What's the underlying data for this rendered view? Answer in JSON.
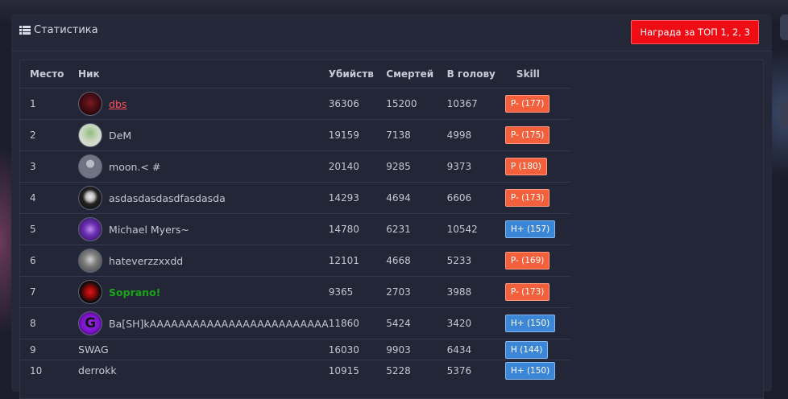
{
  "header": {
    "title": "Статистика",
    "title_icon": "list-icon",
    "reward_button": "Награда за ТОП 1, 2, 3",
    "reward_color": "#f00c14"
  },
  "table": {
    "columns": {
      "rank": "Место",
      "nick": "Ник",
      "kills": "Убийств",
      "deaths": "Смертей",
      "headshots": "В голову",
      "skill": "Skill"
    },
    "rows": [
      {
        "rank": "1",
        "nick": "dbs",
        "kills": "36306",
        "deaths": "15200",
        "headshots": "10367",
        "skill": "P- (177)"
      },
      {
        "rank": "2",
        "nick": "DeM",
        "kills": "19159",
        "deaths": "7138",
        "headshots": "4998",
        "skill": "P- (175)"
      },
      {
        "rank": "3",
        "nick": "moon.< #",
        "kills": "20140",
        "deaths": "9285",
        "headshots": "9373",
        "skill": "P (180)"
      },
      {
        "rank": "4",
        "nick": "asdasdasdasdfasdasda",
        "kills": "14293",
        "deaths": "4694",
        "headshots": "6606",
        "skill": "P- (173)"
      },
      {
        "rank": "5",
        "nick": "Michael Myers~",
        "kills": "14780",
        "deaths": "6231",
        "headshots": "10542",
        "skill": "H+ (157)"
      },
      {
        "rank": "6",
        "nick": "hateverzzxxdd",
        "kills": "12101",
        "deaths": "4668",
        "headshots": "5233",
        "skill": "P- (169)"
      },
      {
        "rank": "7",
        "nick": "Soprano!",
        "kills": "9365",
        "deaths": "2703",
        "headshots": "3988",
        "skill": "P- (173)"
      },
      {
        "rank": "8",
        "nick": "Ba[SH]kAAAAAAAAAAAAAAAAAAAAAAAAA",
        "kills": "11860",
        "deaths": "5424",
        "headshots": "3420",
        "skill": "H+ (150)"
      },
      {
        "rank": "9",
        "nick": "SWAG",
        "kills": "16030",
        "deaths": "9903",
        "headshots": "6434",
        "skill": "H (144)"
      },
      {
        "rank": "10",
        "nick": "derrokk",
        "kills": "10915",
        "deaths": "5228",
        "headshots": "5376",
        "skill": "H+ (150)"
      }
    ]
  },
  "colors": {
    "skill_p": "#f4603b",
    "skill_h": "#3b86d6",
    "nick_red": "#ff4d57",
    "nick_green": "#1aa41a"
  }
}
